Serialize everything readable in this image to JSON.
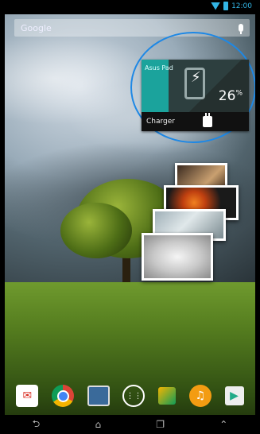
{
  "status_bar": {
    "time": "12:00"
  },
  "search": {
    "label": "Google"
  },
  "battery_widget": {
    "device_name": "Asus Pad",
    "percent": "26",
    "percent_unit": "%",
    "footer_label": "Charger"
  },
  "dock": {
    "apps": [
      "gmail-icon",
      "chrome-icon",
      "gallery-icon",
      "app-drawer-icon",
      "notes-icon",
      "music-icon",
      "play-store-icon"
    ]
  },
  "navbar": {
    "buttons": [
      "back-icon",
      "home-icon",
      "recent-apps-icon",
      "menu-icon"
    ]
  }
}
